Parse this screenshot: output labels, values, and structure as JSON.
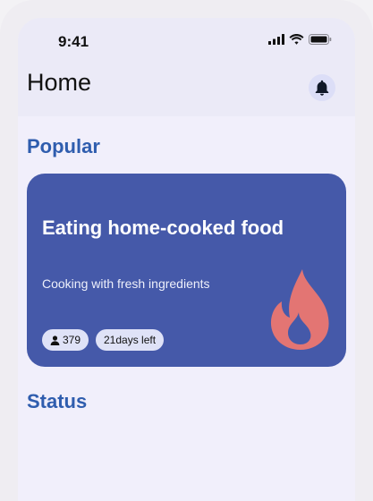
{
  "status_bar": {
    "time": "9:41"
  },
  "header": {
    "title": "Home"
  },
  "sections": {
    "popular": "Popular",
    "status": "Status"
  },
  "card": {
    "title": "Eating home-cooked food",
    "subtitle": "Cooking with fresh ingredients",
    "participants": "379",
    "days_left": "21days left",
    "icon": "fire-icon"
  },
  "colors": {
    "card_bg": "#4559a9",
    "section_title": "#2f5dae",
    "fire": "#e37573",
    "chip_bg": "#dfe2f7"
  }
}
